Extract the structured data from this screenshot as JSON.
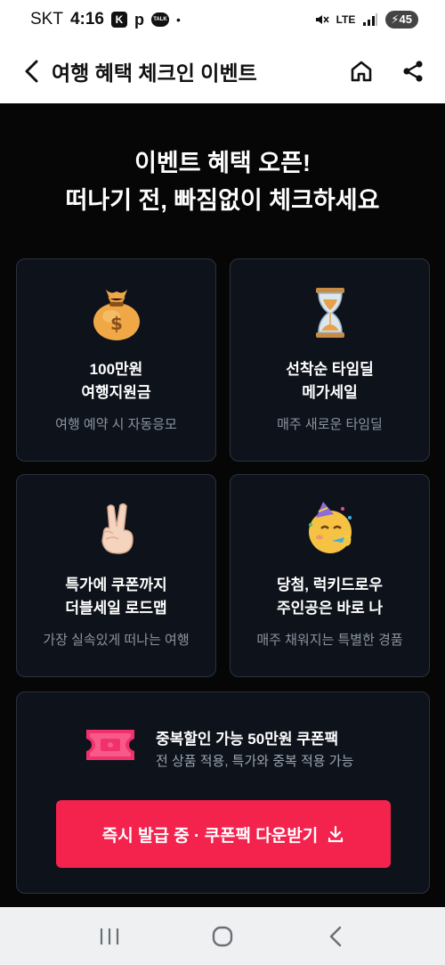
{
  "status_bar": {
    "carrier": "SKT",
    "time": "4:16",
    "app_icon_letter": "K",
    "p_icon": "p",
    "talk_icon": "TALK",
    "dot": "•",
    "network": "LTE",
    "battery": "45"
  },
  "app_bar": {
    "title": "여행 혜택 체크인 이벤트",
    "icons": [
      "back-icon",
      "home-icon",
      "share-icon"
    ]
  },
  "headline": {
    "line1": "이벤트 혜택 오픈!",
    "line2": "떠나기 전, 빠짐없이 체크하세요"
  },
  "cards": [
    {
      "icon": "money-bag-icon",
      "title1": "100만원",
      "title2": "여행지원금",
      "subtitle": "여행 예약 시 자동응모"
    },
    {
      "icon": "hourglass-icon",
      "title1": "선착순 타임딜",
      "title2": "메가세일",
      "subtitle": "매주 새로운 타임딜"
    },
    {
      "icon": "victory-hand-icon",
      "title1": "특가에 쿠폰까지",
      "title2": "더블세일 로드맵",
      "subtitle": "가장 실속있게 떠나는 여행"
    },
    {
      "icon": "party-face-icon",
      "title1": "당첨, 럭키드로우",
      "title2": "주인공은 바로 나",
      "subtitle": "매주 채워지는 특별한 경품"
    }
  ],
  "coupon": {
    "icon": "ticket-icon",
    "title": "중복할인 가능 50만원 쿠폰팩",
    "subtitle": "전 상품 적용, 특가와 중복 적용 가능",
    "button_label": "즉시 발급 중 · 쿠폰팩 다운받기",
    "button_color": "#f3234d"
  },
  "nav_bar": {
    "icons": [
      "recent-apps-icon",
      "home-button-icon",
      "back-button-icon"
    ]
  }
}
